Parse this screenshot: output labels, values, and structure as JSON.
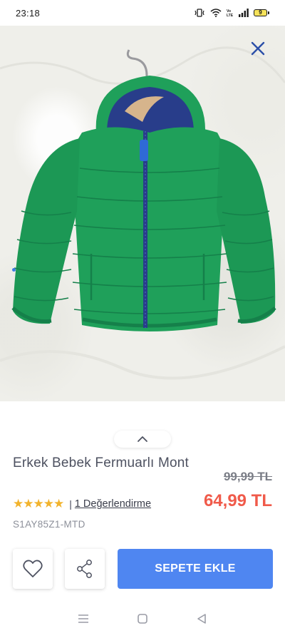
{
  "status_bar": {
    "time": "23:18",
    "battery": "9"
  },
  "product": {
    "name": "Erkek Bebek Fermuarlı Mont",
    "old_price": "99,99 TL",
    "new_price": "64,99 TL",
    "stars": "★★★★★",
    "separator": "|",
    "review_link": "1 Değerlendirme",
    "sku": "S1AY85Z1-MTD"
  },
  "actions": {
    "add_to_cart": "SEPETE EKLE"
  },
  "colors": {
    "accent": "#4f86f1",
    "price_red": "#f05a4a",
    "star": "#f2b32c",
    "jacket_green": "#1fa05a",
    "jacket_lining": "#283d8a",
    "close_icon": "#2b4fa8"
  },
  "icons": [
    "close-icon",
    "chevron-up-icon",
    "heart-icon",
    "share-icon",
    "menu-icon",
    "home-icon",
    "back-icon"
  ]
}
